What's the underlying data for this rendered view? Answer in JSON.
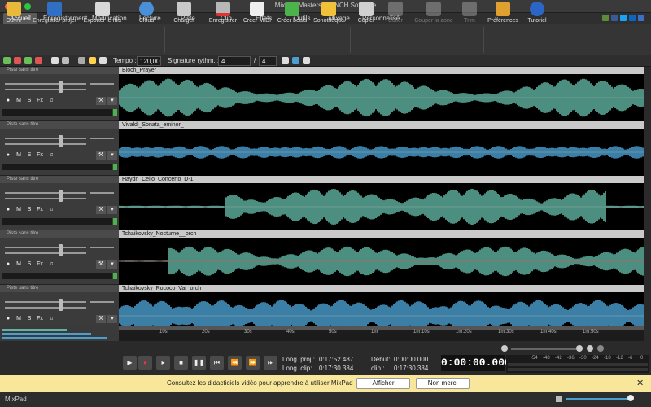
{
  "window": {
    "title": "MixPad Masters par NCH Software"
  },
  "menu": [
    "Accueil",
    "Enregistrement",
    "Modification",
    "Lecture",
    "Piste",
    "Clip",
    "Effets",
    "Outils",
    "Mixage",
    "Personnalisé"
  ],
  "toolbar": [
    {
      "label": "Ouvrir",
      "icon": "folder-icon",
      "enabled": true
    },
    {
      "label": "Enregistrer projet",
      "icon": "save-icon",
      "enabled": true
    },
    {
      "label": "Exporter le mix",
      "icon": "export-icon",
      "enabled": true
    },
    {
      "label": "Cloud",
      "icon": "cloud-icon",
      "enabled": true
    },
    {
      "label": "Charger",
      "icon": "load-icon",
      "enabled": true
    },
    {
      "label": "Enregistrer",
      "icon": "record-icon",
      "enabled": true
    },
    {
      "label": "Créer MIDI",
      "icon": "midi-icon",
      "enabled": true
    },
    {
      "label": "Créer beats",
      "icon": "beats-icon",
      "enabled": true
    },
    {
      "label": "Sonothèque",
      "icon": "sound-library-icon",
      "enabled": true
    },
    {
      "label": "Copier",
      "icon": "copy-icon",
      "enabled": true
    },
    {
      "label": "Coller",
      "icon": "paste-icon",
      "enabled": false
    },
    {
      "label": "Couper la zone",
      "icon": "cut-region-icon",
      "enabled": false
    },
    {
      "label": "Trim",
      "icon": "trim-icon",
      "enabled": false
    },
    {
      "label": "Préférences",
      "icon": "preferences-icon",
      "enabled": true
    },
    {
      "label": "Tutoriel",
      "icon": "tutorial-icon",
      "enabled": true
    }
  ],
  "toolbar2": {
    "tempo_label": "Tempo :",
    "tempo_value": "120,00",
    "signature_label": "Signature rythm. :",
    "sig_num": "4",
    "sig_slash": "/",
    "sig_den": "4"
  },
  "track_header_label": "Piste sans titre",
  "track_buttons": {
    "mute": "M",
    "solo": "S",
    "fx": "Fx"
  },
  "tracks": [
    {
      "clip": "Bloch_Prayer"
    },
    {
      "clip": "Vivaldi_Sonata_eminor_"
    },
    {
      "clip": "Haydn_Cello_Concerto_D-1"
    },
    {
      "clip": "Tchaikovsky_Nocturne__orch"
    },
    {
      "clip": "Tchaikovsky_Rococo_Var_orch"
    }
  ],
  "ruler": [
    "10s",
    "20s",
    "30s",
    "40s",
    "50s",
    "1m",
    "1m:10s",
    "1m:20s",
    "1m:30s",
    "1m:40s",
    "1m:50s"
  ],
  "vu_scale": [
    "-54",
    "-48",
    "-42",
    "-36",
    "-30",
    "-24",
    "-18",
    "-12",
    "-6",
    "0"
  ],
  "transport": {
    "proj_len_label": "Long. proj.:",
    "proj_len": "0:17:52.487",
    "clip_len_label": "Long. clip:",
    "clip_len": "0:17:30.384",
    "start_label": "Début:",
    "start": "0:00:00.000",
    "clip_label": "clip :",
    "clip_val": "0:17:30.384",
    "time": "0:00:00.000"
  },
  "notice": {
    "text": "Consultez les didacticiels vidéo pour apprendre à utiliser MixPad",
    "show": "Afficher",
    "no": "Non merci"
  },
  "status": {
    "app": "MixPad"
  },
  "colors": {
    "wave_green": "#5fb3a0",
    "wave_blue": "#4a9fd0",
    "accent": "#ffd34d"
  }
}
